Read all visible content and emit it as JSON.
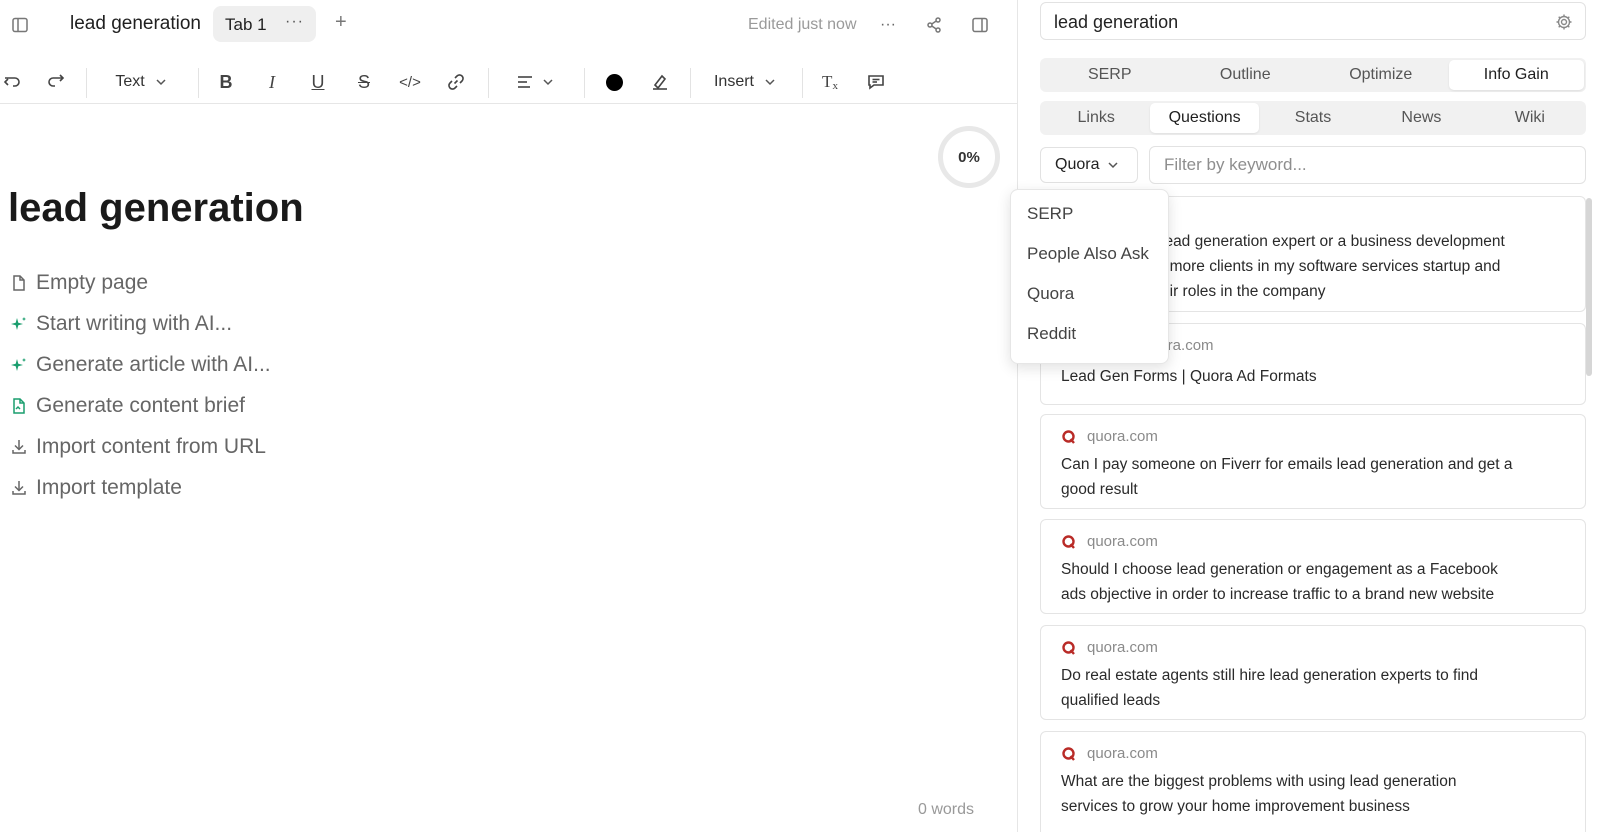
{
  "header": {
    "title": "lead generation",
    "tab_label": "Tab 1",
    "status": "Edited just now",
    "icons": [
      "sidebar-toggle-icon",
      "more-icon",
      "add-tab-icon",
      "share-icon",
      "panel-toggle-icon"
    ]
  },
  "toolbar": {
    "text_style": "Text",
    "insert_label": "Insert",
    "text_color": "#000000"
  },
  "editor": {
    "heading": "lead generation",
    "progress": "0%",
    "word_count": "0 words",
    "actions": [
      {
        "icon": "file-icon",
        "label": "Empty page"
      },
      {
        "icon": "sparkle-icon",
        "label": "Start writing with AI..."
      },
      {
        "icon": "sparkle-icon",
        "label": "Generate article with AI..."
      },
      {
        "icon": "brief-icon",
        "label": "Generate content brief"
      },
      {
        "icon": "download-icon",
        "label": "Import content from URL"
      },
      {
        "icon": "download-icon",
        "label": "Import template"
      }
    ]
  },
  "panel": {
    "search_value": "lead generation",
    "main_tabs": [
      "SERP",
      "Outline",
      "Optimize",
      "Info Gain"
    ],
    "active_main_tab": "Info Gain",
    "sub_tabs": [
      "Links",
      "Questions",
      "Stats",
      "News",
      "Wiki"
    ],
    "active_sub_tab": "Questions",
    "source_select": "Quora",
    "filter_placeholder": "Filter by keyword...",
    "source_options": [
      "SERP",
      "People Also Ask",
      "Quora",
      "Reddit"
    ],
    "results": [
      {
        "source": "",
        "line1": "lead generation expert or a business development",
        "line2": "t more clients in my software services startup and",
        "line3": "eir roles in the company"
      },
      {
        "source": "uora.com",
        "line1": "Lead Gen Forms | Quora Ad Formats"
      },
      {
        "source": "quora.com",
        "line1": "Can I pay someone on Fiverr for emails lead generation and get a",
        "line2": "good result"
      },
      {
        "source": "quora.com",
        "line1": "Should I choose lead generation or engagement as a Facebook",
        "line2": "ads objective in order to increase traffic to a brand new website"
      },
      {
        "source": "quora.com",
        "line1": "Do real estate agents still hire lead generation experts to find",
        "line2": "qualified leads"
      },
      {
        "source": "quora.com",
        "line1": "What are the biggest problems with using lead generation",
        "line2": "services to grow your home improvement business"
      }
    ]
  },
  "colors": {
    "accent_green": "#1a9e6e",
    "quora_red": "#b92b27"
  }
}
